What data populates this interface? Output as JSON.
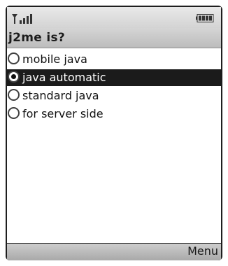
{
  "status_bar": {
    "signal_icon": "signal-strength-icon",
    "battery_icon": "battery-icon"
  },
  "title": "j2me is?",
  "options": [
    {
      "label": "mobile java",
      "selected": false
    },
    {
      "label": "java automatic",
      "selected": true
    },
    {
      "label": "standard java",
      "selected": false
    },
    {
      "label": "for server side",
      "selected": false
    }
  ],
  "softkeys": {
    "right": "Menu"
  },
  "colors": {
    "selection_background": "#1b1b1b",
    "selection_text": "#ffffff",
    "bar_gray": "#c8c8c8"
  }
}
